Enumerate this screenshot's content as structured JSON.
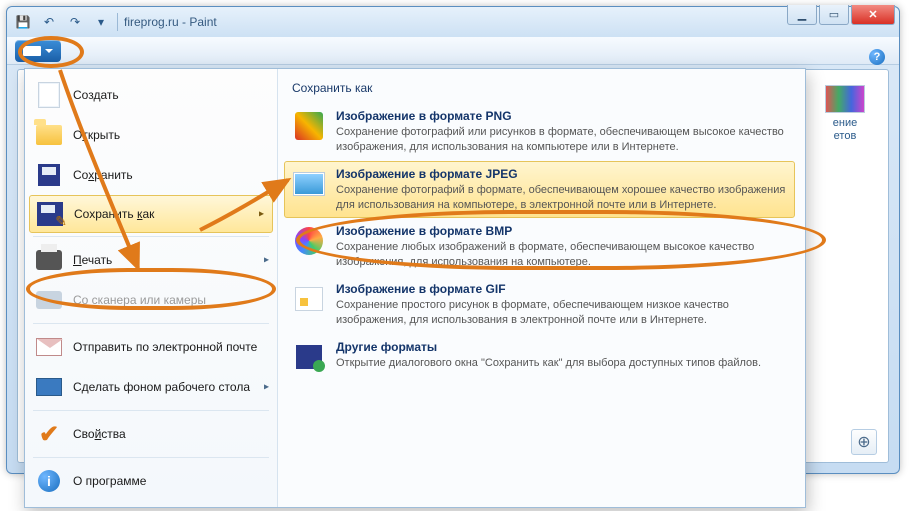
{
  "window": {
    "title": "fireprog.ru - Paint",
    "controls": {
      "min": "▁",
      "max": "▭",
      "close": "✕"
    }
  },
  "qat": {
    "save": "💾",
    "undo": "↶",
    "redo": "↷",
    "custom": "▾"
  },
  "help": "?",
  "colors_panel": {
    "label1": "ение",
    "label2": "етов"
  },
  "zoom": "⊕",
  "menu": {
    "new": "Создать",
    "open_pre": "О",
    "open_u": "т",
    "open_post": "крыть",
    "save_pre": "Со",
    "save_u": "х",
    "save_post": "ранить",
    "saveas_pre": "Сохранить ",
    "saveas_u": "к",
    "saveas_post": "ак",
    "print_u": "П",
    "print_post": "ечать",
    "scanner": "Со сканера или камеры",
    "email": "Отправить по электронной почте",
    "desktop": "Сделать фоном рабочего стола",
    "props_pre": "Сво",
    "props_u": "й",
    "props_post": "ства",
    "about": "О программе",
    "arrow": "▸"
  },
  "submenu": {
    "title": "Сохранить как",
    "items": [
      {
        "title": "Изображение в формате PNG",
        "desc": "Сохранение фотографий или рисунков в формате, обеспечивающем высокое качество изображения, для использования на компьютере или в Интернете."
      },
      {
        "title": "Изображение в формате JPEG",
        "desc": "Сохранение фотографий в формате, обеспечивающем хорошее качество изображения для использования на компьютере, в электронной почте или в Интернете."
      },
      {
        "title": "Изображение в формате BMP",
        "desc": "Сохранение любых изображений в формате, обеспечивающем высокое качество изображения, для использования на компьютере."
      },
      {
        "title": "Изображение в формате GIF",
        "desc": "Сохранение простого рисунок в формате, обеспечивающем низкое качество изображения, для использования в электронной почте или в Интернете."
      },
      {
        "title": "Другие форматы",
        "desc": "Открытие диалогового окна \"Сохранить как\" для выбора доступных типов файлов."
      }
    ]
  }
}
